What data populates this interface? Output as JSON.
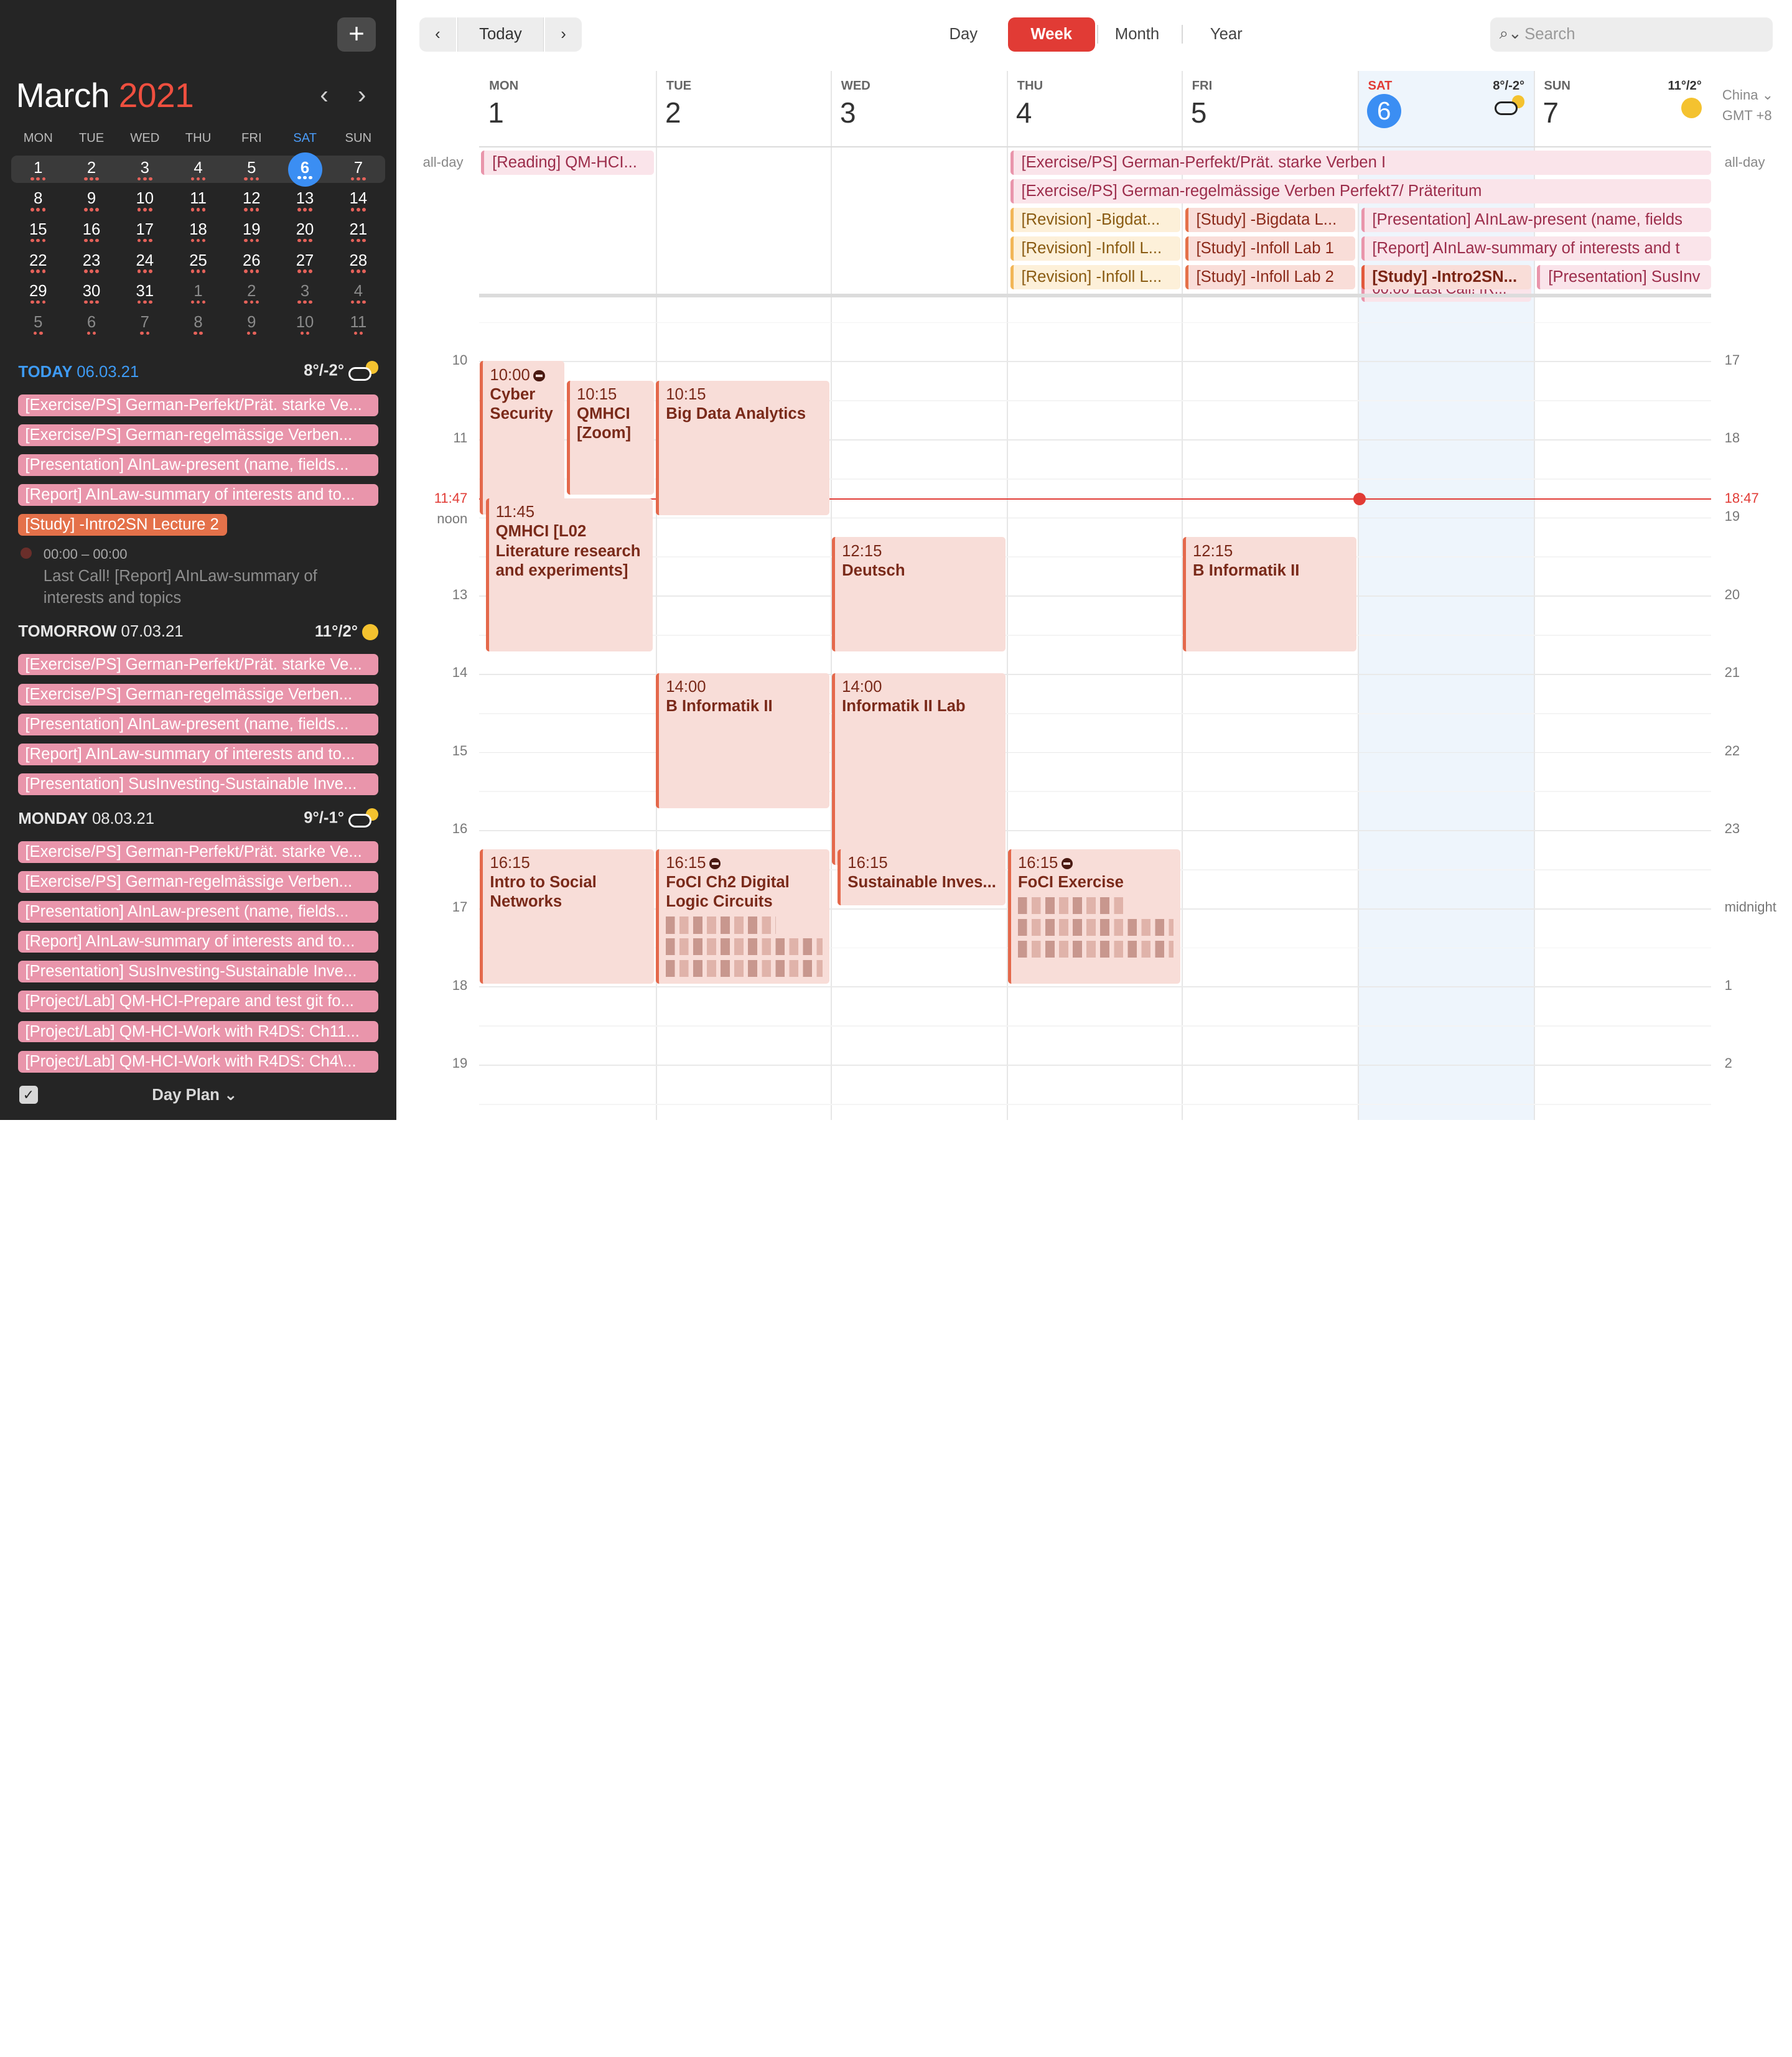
{
  "sidebar": {
    "add_label": "+",
    "month_name": "March",
    "month_year": "2021",
    "prev_label": "‹",
    "next_label": "›",
    "weekdays": [
      "MON",
      "TUE",
      "WED",
      "THU",
      "FRI",
      "SAT",
      "SUN"
    ],
    "weeks": [
      [
        {
          "d": "1",
          "dots": 3
        },
        {
          "d": "2",
          "dots": 3
        },
        {
          "d": "3",
          "dots": 3
        },
        {
          "d": "4",
          "dots": 3
        },
        {
          "d": "5",
          "dots": 3
        },
        {
          "d": "6",
          "dots": 3,
          "today": true
        },
        {
          "d": "7",
          "dots": 3
        }
      ],
      [
        {
          "d": "8",
          "dots": 3
        },
        {
          "d": "9",
          "dots": 3
        },
        {
          "d": "10",
          "dots": 3
        },
        {
          "d": "11",
          "dots": 3
        },
        {
          "d": "12",
          "dots": 3
        },
        {
          "d": "13",
          "dots": 3
        },
        {
          "d": "14",
          "dots": 3
        }
      ],
      [
        {
          "d": "15",
          "dots": 3
        },
        {
          "d": "16",
          "dots": 3
        },
        {
          "d": "17",
          "dots": 3
        },
        {
          "d": "18",
          "dots": 3
        },
        {
          "d": "19",
          "dots": 3
        },
        {
          "d": "20",
          "dots": 3
        },
        {
          "d": "21",
          "dots": 3
        }
      ],
      [
        {
          "d": "22",
          "dots": 3
        },
        {
          "d": "23",
          "dots": 3
        },
        {
          "d": "24",
          "dots": 3
        },
        {
          "d": "25",
          "dots": 3
        },
        {
          "d": "26",
          "dots": 3
        },
        {
          "d": "27",
          "dots": 3
        },
        {
          "d": "28",
          "dots": 3
        }
      ],
      [
        {
          "d": "29",
          "dots": 3
        },
        {
          "d": "30",
          "dots": 3
        },
        {
          "d": "31",
          "dots": 3
        },
        {
          "d": "1",
          "dots": 3,
          "other": true
        },
        {
          "d": "2",
          "dots": 3,
          "other": true
        },
        {
          "d": "3",
          "dots": 3,
          "other": true
        },
        {
          "d": "4",
          "dots": 3,
          "other": true
        }
      ],
      [
        {
          "d": "5",
          "dots": 2,
          "other": true
        },
        {
          "d": "6",
          "dots": 2,
          "other": true
        },
        {
          "d": "7",
          "dots": 2,
          "other": true
        },
        {
          "d": "8",
          "dots": 2,
          "other": true
        },
        {
          "d": "9",
          "dots": 2,
          "other": true
        },
        {
          "d": "10",
          "dots": 2,
          "other": true
        },
        {
          "d": "11",
          "dots": 2,
          "other": true
        }
      ]
    ],
    "today": {
      "label": "TODAY",
      "date": "06.03.21",
      "weather": "8°/-2°",
      "events": [
        "[Exercise/PS] German-Perfekt/Prät. starke Ve...",
        "[Exercise/PS] German-regelmässige Verben...",
        "[Presentation] AInLaw-present (name, fields...",
        "[Report] AInLaw-summary of interests and to...",
        "[Study] -Intro2SN Lecture 2"
      ],
      "lastcall_time": "00:00 – 00:00",
      "lastcall_text": "Last Call! [Report] AInLaw-summary of interests and topics"
    },
    "tomorrow": {
      "label": "TOMORROW",
      "date": "07.03.21",
      "weather": "11°/2°",
      "events": [
        "[Exercise/PS] German-Perfekt/Prät. starke Ve...",
        "[Exercise/PS] German-regelmässige Verben...",
        "[Presentation] AInLaw-present (name, fields...",
        "[Report] AInLaw-summary of interests and to...",
        "[Presentation] SusInvesting-Sustainable Inve..."
      ]
    },
    "monday": {
      "label": "MONDAY",
      "date": "08.03.21",
      "weather": "9°/-1°",
      "events": [
        "[Exercise/PS] German-Perfekt/Prät. starke Ve...",
        "[Exercise/PS] German-regelmässige Verben...",
        "[Presentation] AInLaw-present (name, fields...",
        "[Report] AInLaw-summary of interests and to...",
        "[Presentation] SusInvesting-Sustainable Inve...",
        "[Project/Lab] QM-HCI-Prepare and test git fo...",
        "[Project/Lab] QM-HCI-Work with R4DS: Ch11...",
        "[Project/Lab] QM-HCI-Work with R4DS: Ch4\\..."
      ]
    },
    "footer_label": "Day Plan ⌄"
  },
  "toolbar": {
    "prev": "‹",
    "today": "Today",
    "next": "›",
    "views": [
      "Day",
      "Week",
      "Month",
      "Year"
    ],
    "active_view": "Week",
    "search_placeholder": "Search"
  },
  "week": {
    "days": [
      {
        "wd": "MON",
        "dn": "1"
      },
      {
        "wd": "TUE",
        "dn": "2"
      },
      {
        "wd": "WED",
        "dn": "3"
      },
      {
        "wd": "THU",
        "dn": "4"
      },
      {
        "wd": "FRI",
        "dn": "5"
      },
      {
        "wd": "SAT",
        "dn": "6",
        "weather": "8°/-2°",
        "today": true
      },
      {
        "wd": "SUN",
        "dn": "7",
        "weather": "11°/2°"
      }
    ],
    "timezone": "China ⌄",
    "tz_offset": "GMT +8",
    "allday_label": "all-day",
    "hours_left": [
      "10",
      "11",
      "noon",
      "13",
      "14",
      "15",
      "16",
      "17",
      "18",
      "19"
    ],
    "hours_right": [
      "17",
      "18",
      "19",
      "20",
      "21",
      "22",
      "23",
      "midnight",
      "1",
      "2"
    ],
    "now_left": "11:47",
    "now_right": "18:47"
  },
  "allday": [
    {
      "text": "[Reading] QM-HCI...",
      "style": "pink"
    },
    {
      "text": "[Exercise/PS] German-Perfekt/Prät. starke Verben I",
      "style": "pink"
    },
    {
      "text": "[Exercise/PS] German-regelmässige Verben Perfekt7/ Präteritum",
      "style": "pink"
    },
    {
      "text": "[Revision] -Bigdat...",
      "style": "yel"
    },
    {
      "text": "[Revision] -Infoll L...",
      "style": "yel"
    },
    {
      "text": "[Revision] -Infoll L...",
      "style": "yel"
    },
    {
      "text": "[Study] -Bigdata L...",
      "style": "red"
    },
    {
      "text": "[Study] -Infoll Lab 1",
      "style": "red"
    },
    {
      "text": "[Study] -Infoll Lab 2",
      "style": "red"
    },
    {
      "text": "[Presentation] AInLaw-present (name, fields",
      "style": "pink"
    },
    {
      "text": "[Report] AInLaw-summary of interests and t",
      "style": "pink"
    },
    {
      "text": "[Study] -Intro2SN...",
      "style": "redsolid"
    },
    {
      "text": "[Presentation] SusInv",
      "style": "pink"
    },
    {
      "text": "00:00 Last Call! [R...",
      "style": "pink"
    }
  ],
  "events": [
    {
      "time": "10:00",
      "name": "Cyber Security",
      "zoom": true
    },
    {
      "time": "10:15",
      "name": "QMHCI [Zoom]"
    },
    {
      "time": "10:15",
      "name": "Big Data Analytics"
    },
    {
      "time": "11:45",
      "name": "QMHCI [L02 Literature research and experiments]"
    },
    {
      "time": "12:15",
      "name": "Deutsch"
    },
    {
      "time": "12:15",
      "name": "B Informatik II"
    },
    {
      "time": "14:00",
      "name": "B Informatik II"
    },
    {
      "time": "14:00",
      "name": "Informatik II Lab"
    },
    {
      "time": "16:15",
      "name": "Intro to Social Networks"
    },
    {
      "time": "16:15",
      "name": "FoCI Ch2 Digital Logic Circuits",
      "zoom": true
    },
    {
      "time": "16:15",
      "name": "Sustainable Inves..."
    },
    {
      "time": "16:15",
      "name": "FoCI Exercise",
      "zoom": true
    }
  ],
  "colors": {
    "accent": "#e13b35",
    "today_blue": "#3b8ef3",
    "event_fill": "#f8ddd8",
    "event_border": "#e4684b",
    "sidebar_bg": "#252525"
  }
}
